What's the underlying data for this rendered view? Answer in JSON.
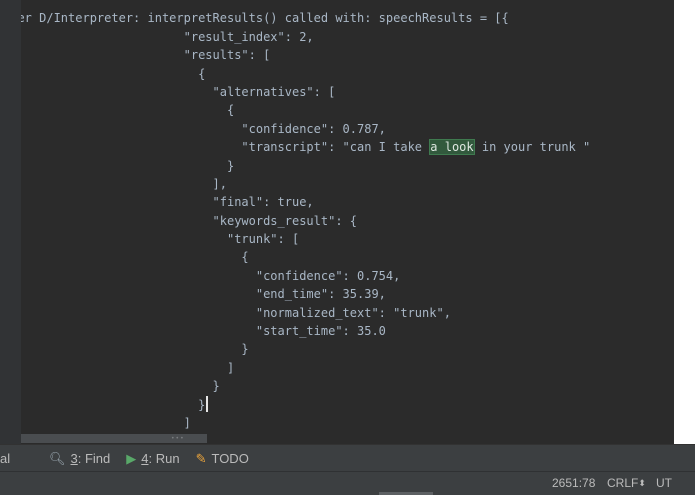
{
  "editor": {
    "lines": [
      "                                                                            ",
      "wyer D/Interpreter: interpretResults() called with: speechResults = [{",
      "                         \"result_index\": 2,",
      "                         \"results\": [",
      "                           {",
      "                             \"alternatives\": [",
      "                               {",
      "                                 \"confidence\": 0.787,",
      "                                 \"transcript\": \"can I take ",
      "                               }",
      "                             ],",
      "                             \"final\": true,",
      "                             \"keywords_result\": {",
      "                               \"trunk\": [",
      "                                 {",
      "                                   \"confidence\": 0.754,",
      "                                   \"end_time\": 35.39,",
      "                                   \"normalized_text\": \"trunk\",",
      "                                   \"start_time\": 35.0",
      "                                 }",
      "                               ]",
      "                             }",
      "                           }",
      "                         ]"
    ],
    "highlight_text": "a look",
    "transcript_tail": " in your trunk \"",
    "top_partial_line": "p...,...............................................",
    "caret_line_index": 22
  },
  "scrollbar": {
    "grip": "•••"
  },
  "toolbar": {
    "terminal_label": "al",
    "find_key": "3",
    "find_label": ": Find",
    "run_key": "4",
    "run_label": ": Run",
    "todo_label": "TODO",
    "icons": {
      "find": "magnifier-icon",
      "run": "run-triangle-icon",
      "todo": "todo-icon"
    }
  },
  "status": {
    "position": "2651:78",
    "line_separator": "CRLF",
    "encoding": "UT"
  },
  "colors": {
    "editor_bg": "#2b2b2b",
    "text": "#a9b7c6",
    "highlight_bg": "#32593d",
    "toolbar_bg": "#3c3f41",
    "run_icon": "#59a869"
  }
}
